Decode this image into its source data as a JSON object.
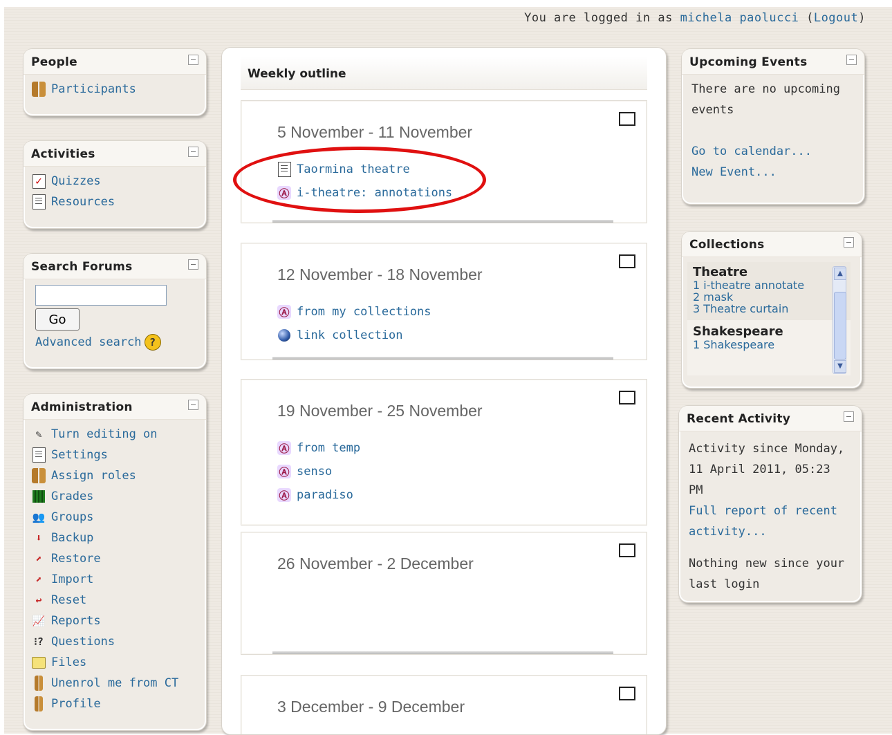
{
  "header": {
    "logged_in_text": "You are logged in as",
    "user_name": "michela paolucci",
    "logout_open": "(",
    "logout_label": "Logout",
    "logout_close": ")"
  },
  "people": {
    "title": "People",
    "items": [
      {
        "label": "Participants",
        "icon": "participants-icon"
      }
    ]
  },
  "activities": {
    "title": "Activities",
    "items": [
      {
        "label": "Quizzes",
        "icon": "quiz-icon"
      },
      {
        "label": "Resources",
        "icon": "resource-icon"
      }
    ]
  },
  "search_forums": {
    "title": "Search Forums",
    "input_value": "",
    "go_label": "Go",
    "advanced_label": "Advanced search"
  },
  "administration": {
    "title": "Administration",
    "items": [
      {
        "label": "Turn editing on",
        "icon": "edit-icon"
      },
      {
        "label": "Settings",
        "icon": "settings-icon"
      },
      {
        "label": "Assign roles",
        "icon": "roles-icon"
      },
      {
        "label": "Grades",
        "icon": "grades-icon"
      },
      {
        "label": "Groups",
        "icon": "groups-icon"
      },
      {
        "label": "Backup",
        "icon": "backup-icon"
      },
      {
        "label": "Restore",
        "icon": "restore-icon"
      },
      {
        "label": "Import",
        "icon": "import-icon"
      },
      {
        "label": "Reset",
        "icon": "reset-icon"
      },
      {
        "label": "Reports",
        "icon": "reports-icon"
      },
      {
        "label": "Questions",
        "icon": "questions-icon"
      },
      {
        "label": "Files",
        "icon": "folder-icon"
      },
      {
        "label": "Unenrol me from CT",
        "icon": "unenrol-icon"
      },
      {
        "label": "Profile",
        "icon": "profile-icon"
      }
    ]
  },
  "main": {
    "title": "Weekly outline",
    "weeks": [
      {
        "title": "5 November - 11 November",
        "items": [
          {
            "label": "Taormina theatre",
            "icon": "resource-icon"
          },
          {
            "label": "i-theatre: annotations",
            "icon": "annotation-icon"
          }
        ]
      },
      {
        "title": "12 November - 18 November",
        "items": [
          {
            "label": "from my collections",
            "icon": "annotation-icon"
          },
          {
            "label": "link collection",
            "icon": "globe-icon"
          }
        ]
      },
      {
        "title": "19 November - 25 November",
        "items": [
          {
            "label": "from temp",
            "icon": "annotation-icon"
          },
          {
            "label": "senso",
            "icon": "annotation-icon"
          },
          {
            "label": "paradiso",
            "icon": "annotation-icon"
          }
        ]
      },
      {
        "title": "26 November - 2 December",
        "items": []
      },
      {
        "title": "3 December - 9 December",
        "items": []
      }
    ]
  },
  "upcoming_events": {
    "title": "Upcoming Events",
    "empty_text": "There are no upcoming events",
    "calendar_link": "Go to calendar...",
    "new_event_link": "New Event..."
  },
  "collections": {
    "title": "Collections",
    "groups": [
      {
        "name": "Theatre",
        "items": [
          "1 i-theatre annotate",
          "2 mask",
          "3 Theatre curtain"
        ]
      },
      {
        "name": "Shakespeare",
        "items": [
          "1 Shakespeare"
        ]
      }
    ]
  },
  "recent_activity": {
    "title": "Recent Activity",
    "since_text": "Activity since Monday, 11 April 2011, 05:23 PM",
    "full_report_link": "Full report of recent activity...",
    "nothing_new": "Nothing new since your last login"
  },
  "colors": {
    "link": "#2a6a9b",
    "highlight": "#e01010",
    "page_background": "#efeae3"
  }
}
